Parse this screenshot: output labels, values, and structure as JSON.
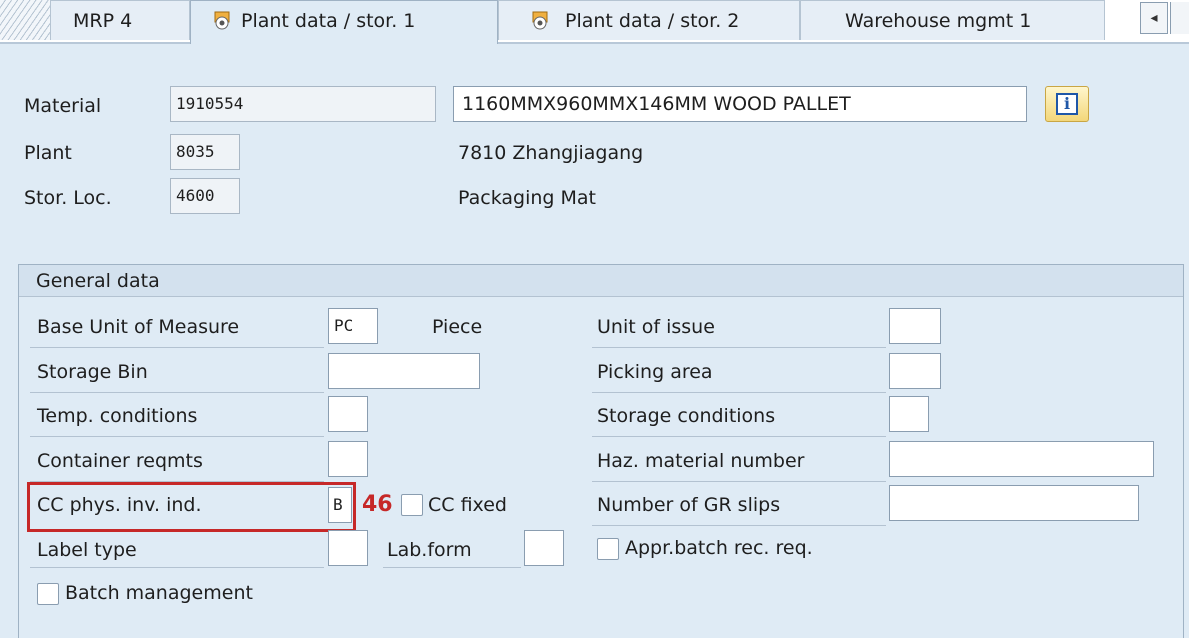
{
  "tabs": [
    {
      "label": "MRP 4"
    },
    {
      "label": "Plant data / stor. 1"
    },
    {
      "label": "Plant data / stor. 2"
    },
    {
      "label": "Warehouse mgmt 1"
    }
  ],
  "header": {
    "material_label": "Material",
    "material_value": "1910554",
    "material_desc": "1160MMX960MMX146MM  WOOD  PALLET",
    "plant_label": "Plant",
    "plant_value": "8035",
    "plant_desc": "7810 Zhangjiagang",
    "storloc_label": "Stor. Loc.",
    "storloc_value": "4600",
    "storloc_desc": "Packaging Mat"
  },
  "general": {
    "title": "General data",
    "base_uom_label": "Base Unit of Measure",
    "base_uom_value": "PC",
    "base_uom_text": "Piece",
    "storage_bin_label": "Storage Bin",
    "storage_bin_value": "",
    "temp_cond_label": "Temp. conditions",
    "temp_cond_value": "",
    "container_label": "Container reqmts",
    "container_value": "",
    "cc_ind_label": "CC phys. inv. ind.",
    "cc_ind_value": "B",
    "cc_fixed_label": "CC fixed",
    "label_type_label": "Label type",
    "label_type_value": "",
    "lab_form_label": "Lab.form",
    "lab_form_value": "",
    "batch_mgmt_label": "Batch management",
    "unit_issue_label": "Unit of issue",
    "unit_issue_value": "",
    "picking_area_label": "Picking area",
    "picking_area_value": "",
    "storage_cond_label": "Storage conditions",
    "storage_cond_value": "",
    "haz_label": "Haz. material number",
    "haz_value": "",
    "gr_slips_label": "Number of GR slips",
    "gr_slips_value": "",
    "appr_batch_label": "Appr.batch rec. req."
  },
  "annotation": {
    "badge": "46",
    "color": "#c62828"
  },
  "icons": {
    "tab_icon": "package-icon",
    "info": "info-icon",
    "scroll": "scroll-left-icon"
  },
  "colors": {
    "background": "#dfebf5",
    "highlight": "#c62828"
  }
}
